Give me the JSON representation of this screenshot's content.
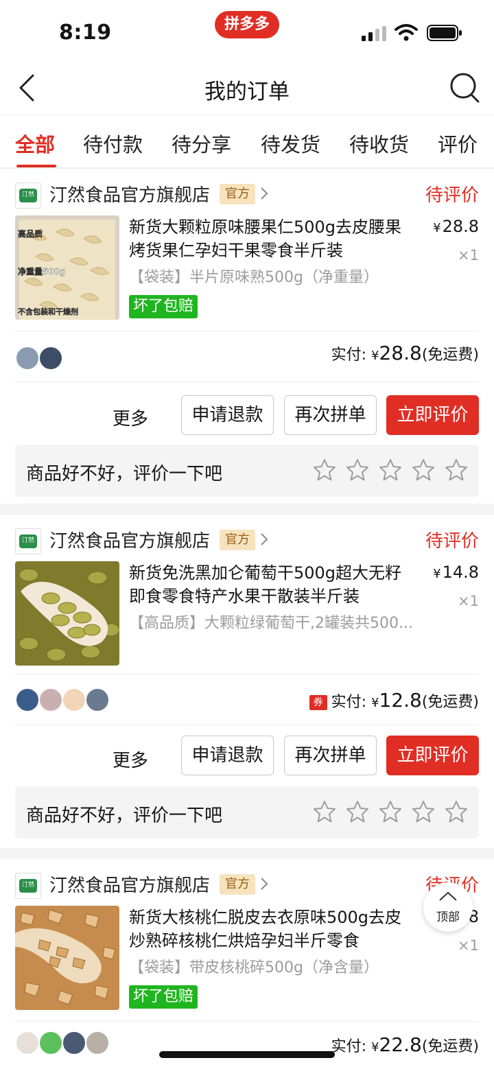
{
  "status_bar": {
    "time": "8:19",
    "app_badge": "拼多多"
  },
  "nav": {
    "title": "我的订单"
  },
  "tabs": [
    {
      "label": "全部",
      "active": true
    },
    {
      "label": "待付款"
    },
    {
      "label": "待分享"
    },
    {
      "label": "待发货"
    },
    {
      "label": "待收货"
    },
    {
      "label": "评价"
    }
  ],
  "orders": [
    {
      "store_name": "汀然食品官方旗舰店",
      "store_logo_text": "汀然",
      "official_badge": "官方",
      "status": "待评价",
      "product_title": "新货大颗粒原味腰果仁500g去皮腰果烤货果仁孕妇干果零食半斤装",
      "product_spec": "【袋装】半片原味熟500g（净重量）",
      "price_symbol": "¥",
      "price": "28.8",
      "quantity": "×1",
      "guarantee": "坏了包赔",
      "image_labels": [
        "高品质",
        "净重量500g",
        "不含包装和干燥剂"
      ],
      "paid_label": "实付:",
      "paid_symbol": "¥",
      "paid_amount": "28.8",
      "shipping": "(免运费)",
      "more": "更多",
      "refund": "申请退款",
      "reorder": "再次拼单",
      "review": "立即评价",
      "review_prompt": "商品好不好，评价一下吧"
    },
    {
      "store_name": "汀然食品官方旗舰店",
      "store_logo_text": "汀然",
      "official_badge": "官方",
      "status": "待评价",
      "product_title": "新货免洗黑加仑葡萄干500g超大无籽即食零食特产水果干散装半斤装",
      "product_spec": "【高品质】大颗粒绿葡萄干,2罐装共500...",
      "price_symbol": "¥",
      "price": "14.8",
      "quantity": "×1",
      "coupon": "券",
      "paid_label": "实付:",
      "paid_symbol": "¥",
      "paid_amount": "12.8",
      "shipping": "(免运费)",
      "more": "更多",
      "refund": "申请退款",
      "reorder": "再次拼单",
      "review": "立即评价",
      "review_prompt": "商品好不好，评价一下吧"
    },
    {
      "store_name": "汀然食品官方旗舰店",
      "store_logo_text": "汀然",
      "official_badge": "官方",
      "status": "待评价",
      "product_title": "新货大核桃仁脱皮去衣原味500g去皮炒熟碎核桃仁烘焙孕妇半斤零食",
      "product_spec": "【袋装】带皮核桃碎500g（净含量）",
      "price_symbol": "¥",
      "price": "22.8",
      "quantity": "×1",
      "guarantee": "坏了包赔",
      "paid_label": "实付:",
      "paid_symbol": "¥",
      "paid_amount": "22.8",
      "shipping": "(免运费)"
    }
  ],
  "back_to_top": "顶部",
  "colors": {
    "brand_red": "#e02e24",
    "official_gold": "#f6e3bd",
    "guarantee_green": "#1fb51f"
  }
}
